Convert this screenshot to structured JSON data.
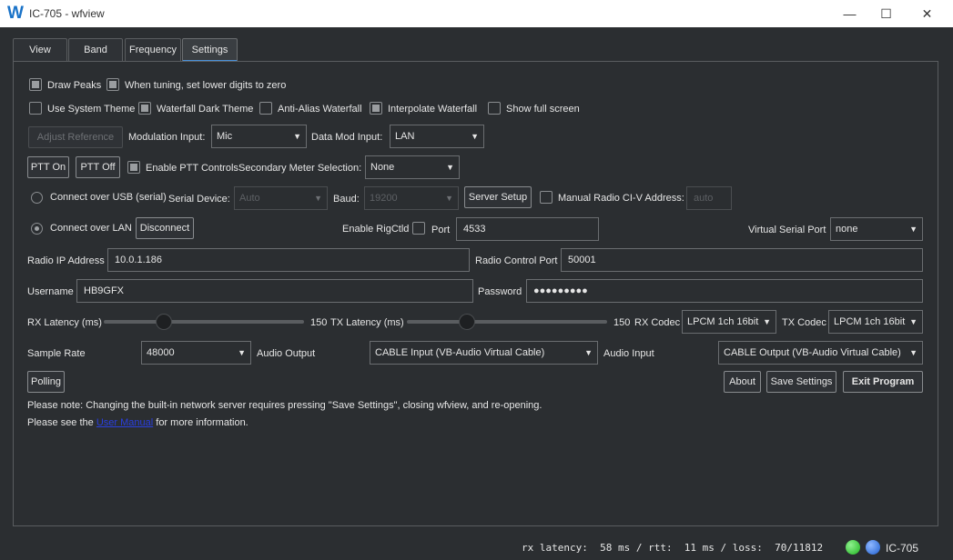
{
  "window": {
    "title": "IC-705 - wfview",
    "logo": "W"
  },
  "tabs": [
    {
      "label": "View"
    },
    {
      "label": "Band"
    },
    {
      "label": "Frequency"
    },
    {
      "label": "Settings"
    }
  ],
  "row1": {
    "draw_peaks": "Draw Peaks",
    "lower_digits": "When tuning, set lower digits to zero"
  },
  "row2": {
    "system_theme": "Use System Theme",
    "waterfall_dark": "Waterfall Dark Theme",
    "anti_alias": "Anti-Alias Waterfall",
    "interpolate": "Interpolate Waterfall",
    "full_screen": "Show full screen"
  },
  "row3": {
    "adjust_reference": "Adjust Reference",
    "modulation_input_label": "Modulation Input:",
    "modulation_input_value": "Mic",
    "data_mod_label": "Data Mod Input:",
    "data_mod_value": "LAN"
  },
  "row4": {
    "ptt_on": "PTT On",
    "ptt_off": "PTT Off",
    "enable_ptt": "Enable PTT Controls",
    "secondary_meter_label": "Secondary Meter Selection:",
    "secondary_meter_value": "None"
  },
  "row5": {
    "connect_usb": "Connect over USB (serial)",
    "serial_device_label": "Serial Device:",
    "serial_device_value": "Auto",
    "baud_label": "Baud:",
    "baud_value": "19200",
    "server_setup": "Server Setup",
    "manual_civ": "Manual Radio CI-V Address:",
    "civ_value": "auto"
  },
  "row6": {
    "connect_lan": "Connect over LAN",
    "disconnect": "Disconnect",
    "enable_rigctld": "Enable RigCtld",
    "port_label": "Port",
    "port_value": "4533",
    "virtual_serial_label": "Virtual Serial Port",
    "virtual_serial_value": "none"
  },
  "row7": {
    "radio_ip_label": "Radio IP Address",
    "radio_ip_value": "10.0.1.186",
    "control_port_label": "Radio Control Port",
    "control_port_value": "50001"
  },
  "row8": {
    "username_label": "Username",
    "username_value": "HB9GFX",
    "password_label": "Password",
    "password_value": "●●●●●●●●●"
  },
  "row9": {
    "rx_latency_label": "RX Latency (ms)",
    "rx_latency_value": "150",
    "rx_latency_fraction": 0.28,
    "tx_latency_label": "TX Latency (ms)",
    "tx_latency_value": "150",
    "tx_latency_fraction": 0.28,
    "rx_codec_label": "RX Codec",
    "rx_codec_value": "LPCM 1ch 16bit",
    "tx_codec_label": "TX Codec",
    "tx_codec_value": "LPCM 1ch 16bit"
  },
  "row10": {
    "sample_rate_label": "Sample Rate",
    "sample_rate_value": "48000",
    "audio_output_label": "Audio Output",
    "audio_output_value": "CABLE Input (VB-Audio Virtual Cable)",
    "audio_input_label": "Audio Input",
    "audio_input_value": "CABLE Output (VB-Audio Virtual Cable)"
  },
  "row11": {
    "polling": "Polling",
    "about": "About",
    "save_settings": "Save Settings",
    "exit": "Exit Program"
  },
  "notes": {
    "note1": "Please note: Changing  the built-in network server requires pressing \"Save Settings\", closing wfview, and re-opening.",
    "note2_pre": "Please see the ",
    "note2_link": "User Manual",
    "note2_post": " for more information."
  },
  "status": {
    "text": "rx latency:  58 ms / rtt:  11 ms / loss:  70/11812",
    "radio": "IC-705",
    "colors": {
      "ok": "#1fb51f",
      "blue": "#1e5fd0"
    }
  }
}
